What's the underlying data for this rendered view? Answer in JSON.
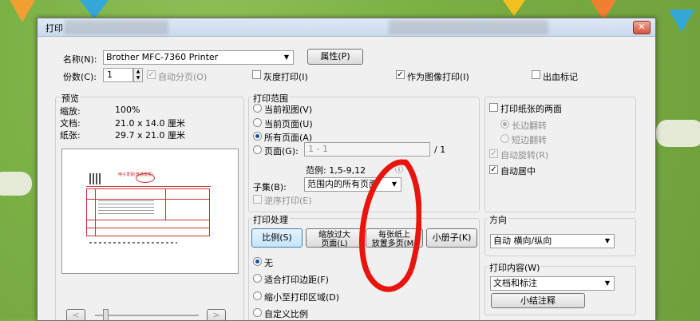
{
  "dialog": {
    "title": "打印",
    "close": "✕",
    "name_label": "名称(N):",
    "printer_name": "Brother MFC-7360 Printer",
    "properties_button": "属性(P)",
    "copies_label": "份数(C):",
    "copies_value": "1",
    "collate_label": "自动分页(O)",
    "grayscale_label": "灰度打印(I)",
    "print_as_image_label": "作为图像打印(I)",
    "bleed_marks_label": "出血标记"
  },
  "preview": {
    "title": "预览",
    "scale_label": "缩放:",
    "scale_value": "100%",
    "document_label": "文档:",
    "document_value": "21.0 x 14.0 厘米",
    "paper_label": "纸张:",
    "paper_value": "29.7 x 21.0 厘米",
    "page_title_text": "电子发票(普通发票)"
  },
  "print_range": {
    "title": "打印范围",
    "options": [
      "当前视图(V)",
      "当前页面(U)",
      "所有页面(A)",
      "页面(G):"
    ],
    "pages_placeholder": "1 - 1",
    "pages_total": "/ 1",
    "example": "范例: 1,5-9,12",
    "subset_label": "子集(B):",
    "subset_value": "范围内的所有页面",
    "reverse_label": "逆序打印(E)"
  },
  "duplex": {
    "both_sides_label": "打印纸张的两面",
    "long_edge_label": "长边翻转",
    "short_edge_label": "短边翻转",
    "auto_rotate_label": "自动旋转(R)",
    "auto_center_label": "自动居中"
  },
  "page_handling": {
    "title": "打印处理",
    "tabs": [
      "比例(S)",
      "缩放过大\n页面(L)",
      "每张纸上\n放置多页(M)",
      "小册子(K)"
    ],
    "options": [
      "无",
      "适合打印边距(F)",
      "缩小至打印区域(D)",
      "自定义比例"
    ]
  },
  "orientation": {
    "title": "方向",
    "value": "自动 横向/纵向"
  },
  "print_content": {
    "title": "打印内容(W)",
    "value": "文档和标注",
    "summarize_button": "小结注释"
  },
  "nav": {
    "prev": "<",
    "next": ">"
  }
}
